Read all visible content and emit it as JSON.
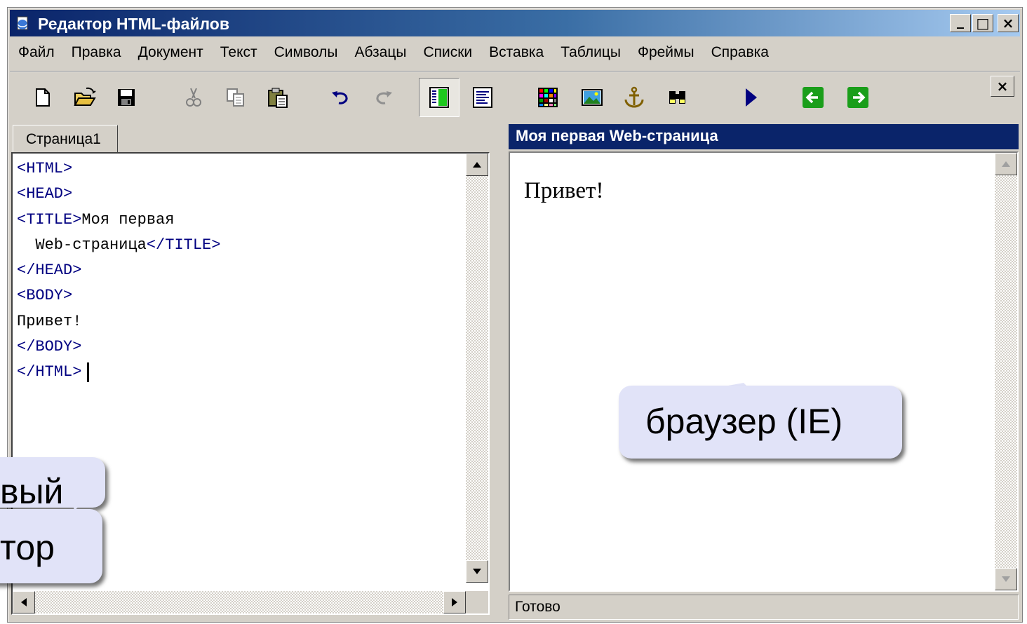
{
  "window": {
    "title": "Редактор HTML-файлов",
    "controls": {
      "minimize": "_",
      "maximize": "□",
      "close": "×"
    }
  },
  "menu": {
    "items": [
      "Файл",
      "Правка",
      "Документ",
      "Текст",
      "Символы",
      "Абзацы",
      "Списки",
      "Вставка",
      "Таблицы",
      "Фреймы",
      "Справка"
    ]
  },
  "toolbar": {
    "buttons": [
      "new-file",
      "open-folder",
      "save",
      "cut",
      "copy",
      "paste",
      "undo",
      "redo",
      "split-view",
      "text-view",
      "table",
      "image",
      "anchor",
      "find",
      "run",
      "back",
      "forward"
    ],
    "close_label": "×",
    "colors": {
      "green": "#1a9e1a",
      "blue": "#000080"
    }
  },
  "editor": {
    "tab_label": "Страница1",
    "lines": [
      {
        "tag1": "<HTML>",
        "text": "",
        "tag2": ""
      },
      {
        "tag1": "<HEAD>",
        "text": "",
        "tag2": ""
      },
      {
        "tag1": "<TITLE>",
        "text": "Моя первая",
        "tag2": ""
      },
      {
        "tag1": "",
        "text": "  Web-страница",
        "tag2": "</TITLE>"
      },
      {
        "tag1": "</HEAD>",
        "text": "",
        "tag2": ""
      },
      {
        "tag1": "<BODY>",
        "text": "",
        "tag2": ""
      },
      {
        "tag1": "",
        "text": "Привет!",
        "tag2": ""
      },
      {
        "tag1": "</BODY>",
        "text": "",
        "tag2": ""
      },
      {
        "tag1": "</HTML>",
        "text": "",
        "tag2": ""
      }
    ]
  },
  "browser": {
    "title": "Моя первая Web-страница",
    "content": "Привет!",
    "status": "Готово"
  },
  "callouts": {
    "browser": "браузер (IE)",
    "editor_line1": "вый",
    "editor_line2": "тор"
  }
}
